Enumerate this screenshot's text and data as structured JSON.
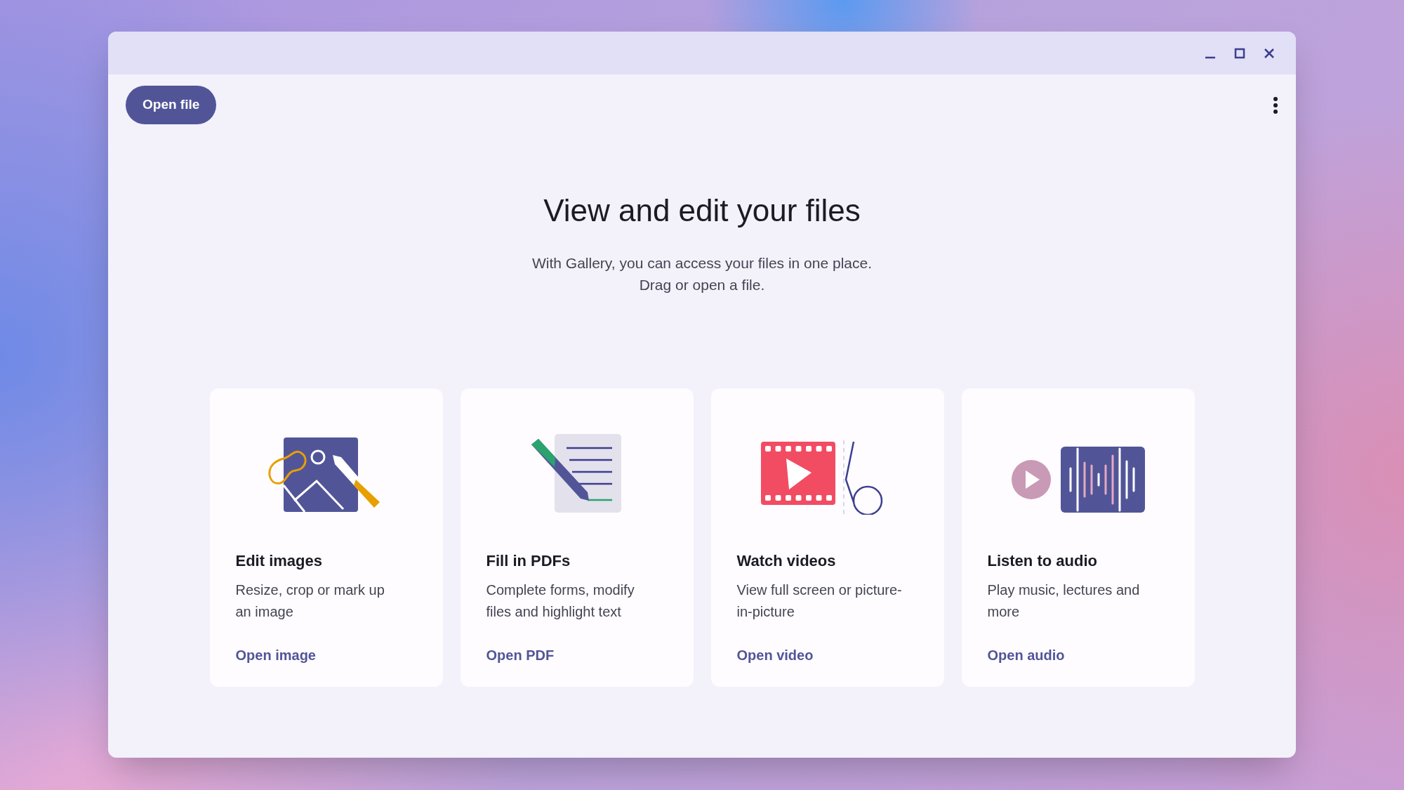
{
  "toolbar": {
    "open_button": "Open file"
  },
  "hero": {
    "title": "View and edit your files",
    "lines": [
      "With Gallery, you can access your files in one place.",
      "Drag or open a file."
    ]
  },
  "cards": [
    {
      "kind": "image",
      "title": "Edit images",
      "description": "Resize, crop or mark up an image",
      "link": "Open image"
    },
    {
      "kind": "pdf",
      "title": "Fill in PDFs",
      "description": "Complete forms, modify files and highlight text",
      "link": "Open PDF"
    },
    {
      "kind": "video",
      "title": "Watch videos",
      "description": "View full screen or picture-in-picture",
      "link": "Open video"
    },
    {
      "kind": "audio",
      "title": "Listen to audio",
      "description": "Play music, lectures and more",
      "link": "Open audio"
    }
  ]
}
